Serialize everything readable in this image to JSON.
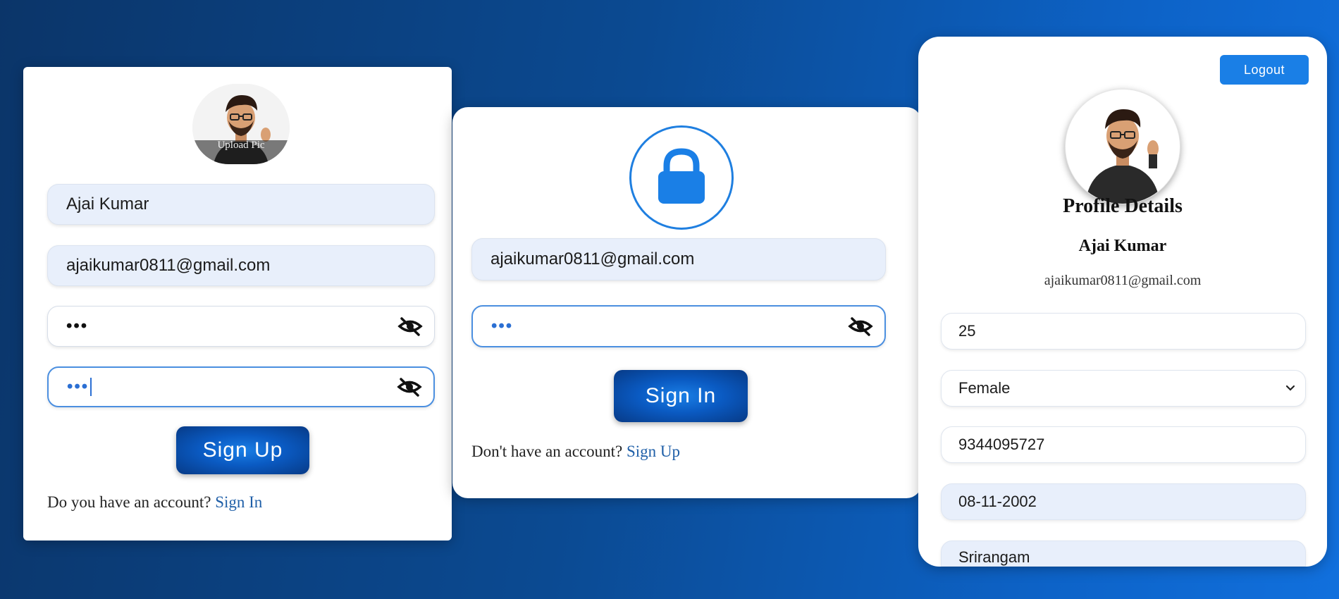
{
  "signup": {
    "upload_label": "Upload Pic",
    "name_value": "Ajai Kumar",
    "email_value": "ajaikumar0811@gmail.com",
    "password_value": "•••",
    "confirm_password_value": "•••",
    "button_label": "Sign Up",
    "footer_prefix": "Do you have an account?",
    "footer_link": "Sign In"
  },
  "signin": {
    "email_value": "ajaikumar0811@gmail.com",
    "password_value": "•••",
    "button_label": "Sign In",
    "footer_prefix": "Don't have an account?",
    "footer_link": "Sign Up"
  },
  "profile": {
    "logout_label": "Logout",
    "title": "Profile Details",
    "name": "Ajai Kumar",
    "email": "ajaikumar0811@gmail.com",
    "age": "25",
    "gender_selected": "Female",
    "phone": "9344095727",
    "dob": "08-11-2002",
    "city": "Srirangam"
  },
  "icons": {
    "password_toggle": "eye-slash-icon",
    "lock": "lock-icon",
    "dropdown": "chevron-down-icon"
  },
  "colors": {
    "accent": "#1a7fe6",
    "link": "#1f5fa8",
    "field_fill": "#e8effb"
  }
}
